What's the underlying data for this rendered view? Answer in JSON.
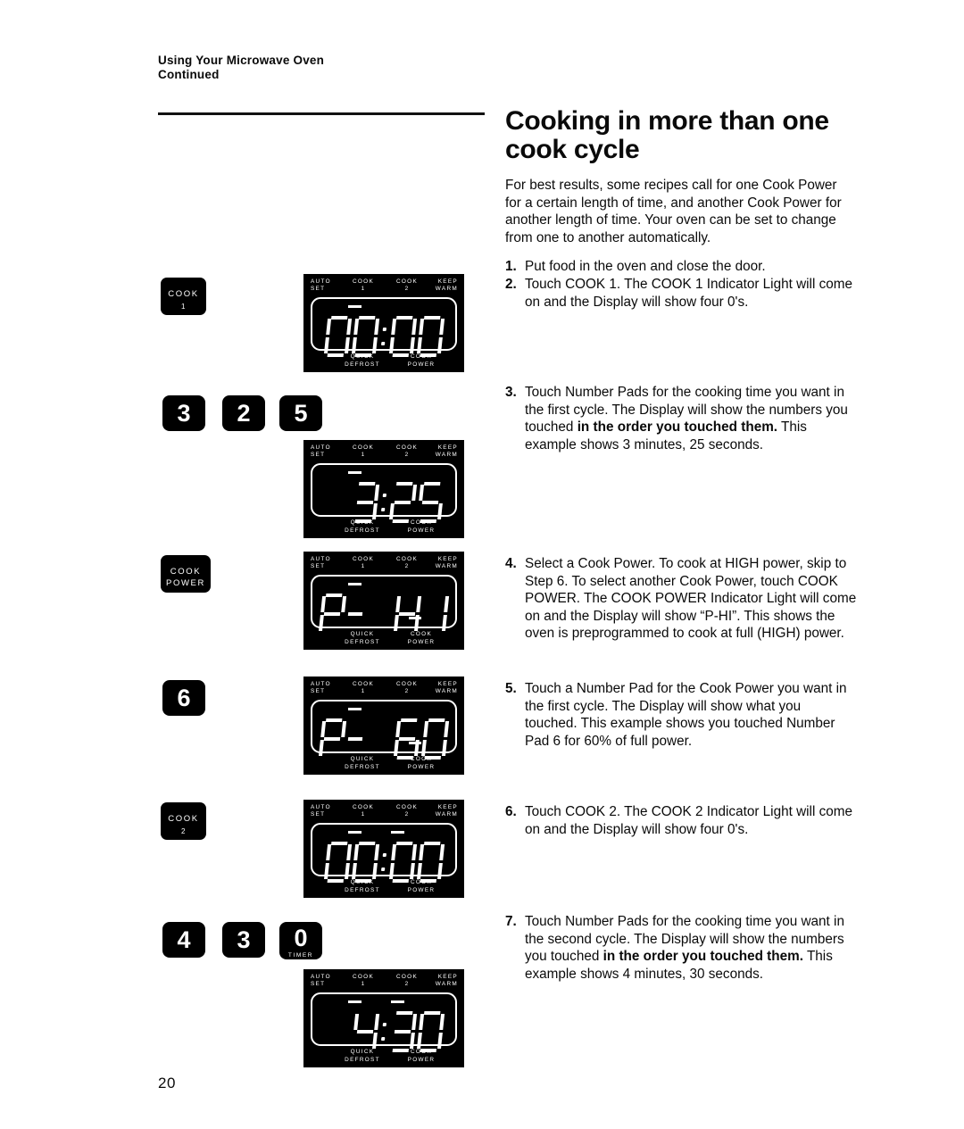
{
  "running_head": {
    "line1": "Using Your Microwave Oven",
    "line2": "Continued"
  },
  "section": {
    "title": "Cooking in more than one cook cycle",
    "intro": "For best results, some recipes call for one Cook Power for a certain length of time, and another Cook Power for another length of time. Your oven can be set to change from one to another automatically."
  },
  "steps": [
    {
      "number": "1.",
      "text_before": "Put food in the oven and close the door.",
      "bold": "",
      "text_after": ""
    },
    {
      "number": "2.",
      "text_before": "Touch COOK 1. The COOK 1 Indicator Light will come on and the Display will show four 0's.",
      "bold": "",
      "text_after": ""
    },
    {
      "number": "3.",
      "text_before": "Touch Number Pads for the cooking time you want in the first cycle. The Display will show the numbers you touched ",
      "bold": "in the order you touched them.",
      "text_after": " This example shows 3 minutes, 25 seconds."
    },
    {
      "number": "4.",
      "text_before": "Select a Cook Power. To cook at HIGH power, skip to Step 6. To select another Cook Power, touch COOK POWER. The COOK POWER Indicator Light will come on and the Display will show “P-HI”. This shows the oven is preprogrammed to cook at full (HIGH) power.",
      "bold": "",
      "text_after": ""
    },
    {
      "number": "5.",
      "text_before": "Touch a Number Pad for the Cook Power you want in the first cycle. The Display will show what you touched. This example shows you touched Number Pad 6 for 60% of full power.",
      "bold": "",
      "text_after": ""
    },
    {
      "number": "6.",
      "text_before": "Touch COOK 2. The COOK 2 Indicator Light will come on and the Display will show four 0's.",
      "bold": "",
      "text_after": ""
    },
    {
      "number": "7.",
      "text_before": "Touch Number Pads for the cooking time you want in the second cycle. The Display will show the numbers you touched ",
      "bold": "in the order you touched them.",
      "text_after": " This example shows 4 minutes, 30 seconds."
    }
  ],
  "control_panel_labels": {
    "auto_set": "AUTO\nSET",
    "cook_1": "COOK\n1",
    "cook_2": "COOK\n2",
    "keep_warm": "KEEP\nWARM",
    "quick_defrost": "QUICK\nDEFROST",
    "cook_power": "COOK\nPOWER"
  },
  "buttons": {
    "cook1": {
      "line1": "COOK",
      "line2": "1"
    },
    "cook_power": {
      "line1": "COOK",
      "line2": "POWER"
    },
    "cook2": {
      "line1": "COOK",
      "line2": "2"
    }
  },
  "numpads": {
    "row_time1": [
      {
        "digit": "3",
        "sub": ""
      },
      {
        "digit": "2",
        "sub": ""
      },
      {
        "digit": "5",
        "sub": ""
      }
    ],
    "power": [
      {
        "digit": "6",
        "sub": ""
      }
    ],
    "row_time2": [
      {
        "digit": "4",
        "sub": ""
      },
      {
        "digit": "3",
        "sub": ""
      },
      {
        "digit": "0",
        "sub": "TIMER"
      }
    ]
  },
  "displays": [
    {
      "name": "display-cook1-zeros",
      "readout": "00:00",
      "glyphs": [
        "0",
        "0",
        ":",
        "0",
        "0"
      ],
      "indicators": [
        "cook1"
      ]
    },
    {
      "name": "display-time-325",
      "readout": "3:25",
      "glyphs": [
        " ",
        "3",
        ":",
        "2",
        "5"
      ],
      "indicators": [
        "cook1"
      ]
    },
    {
      "name": "display-power-phi",
      "readout": "P-HI",
      "glyphs": [
        "P",
        "-",
        " ",
        "H",
        "I"
      ],
      "indicators": [
        "cook1",
        "cookpower"
      ]
    },
    {
      "name": "display-power-p60",
      "readout": "P-60",
      "glyphs": [
        "P",
        "-",
        " ",
        "6",
        "0"
      ],
      "indicators": [
        "cook1",
        "cookpower"
      ]
    },
    {
      "name": "display-cook2-zeros",
      "readout": "00:00",
      "glyphs": [
        "0",
        "0",
        ":",
        "0",
        "0"
      ],
      "indicators": [
        "cook1",
        "cook2"
      ]
    },
    {
      "name": "display-time-430",
      "readout": "4:30",
      "glyphs": [
        " ",
        "4",
        ":",
        "3",
        "0"
      ],
      "indicators": [
        "cook1",
        "cook2"
      ]
    }
  ],
  "page_number": "20",
  "colors": {
    "ink": "#0a0a0a",
    "panel": "#000000",
    "display_text": "#ffffff",
    "paper": "#ffffff"
  }
}
